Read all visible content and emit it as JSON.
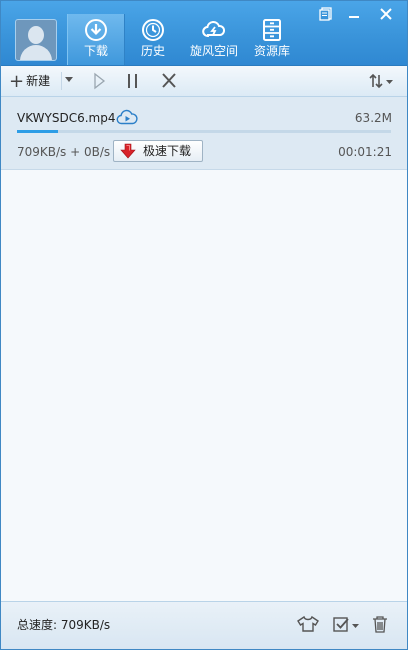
{
  "header": {
    "nav": [
      {
        "label": "下载",
        "icon": "download-icon",
        "active": true
      },
      {
        "label": "历史",
        "icon": "history-clock-icon",
        "active": false
      },
      {
        "label": "旋风空间",
        "icon": "cloud-space-icon",
        "active": false
      },
      {
        "label": "资源库",
        "icon": "resource-library-icon",
        "active": false
      }
    ],
    "window_buttons": [
      "skin-icon",
      "minimize-icon",
      "close-icon"
    ]
  },
  "toolbar": {
    "new_label": "新建",
    "buttons": [
      "play-icon",
      "pause-icon",
      "delete-x-icon",
      "sort-icon"
    ]
  },
  "task": {
    "filename": "VKWYSDC6.mp4",
    "size": "63.2M",
    "progress": 0.11,
    "speed": "709KB/s + 0B/s",
    "accel_label": "极速下载",
    "time": "00:01:21"
  },
  "footer": {
    "total_speed": "总速度: 709KB/s",
    "buttons": [
      "shirt-icon",
      "check-menu-icon",
      "trash-icon"
    ]
  },
  "colors": {
    "header": "#3a94da",
    "progress": "#2d9de6",
    "accel_arrow": "#d8232a"
  }
}
